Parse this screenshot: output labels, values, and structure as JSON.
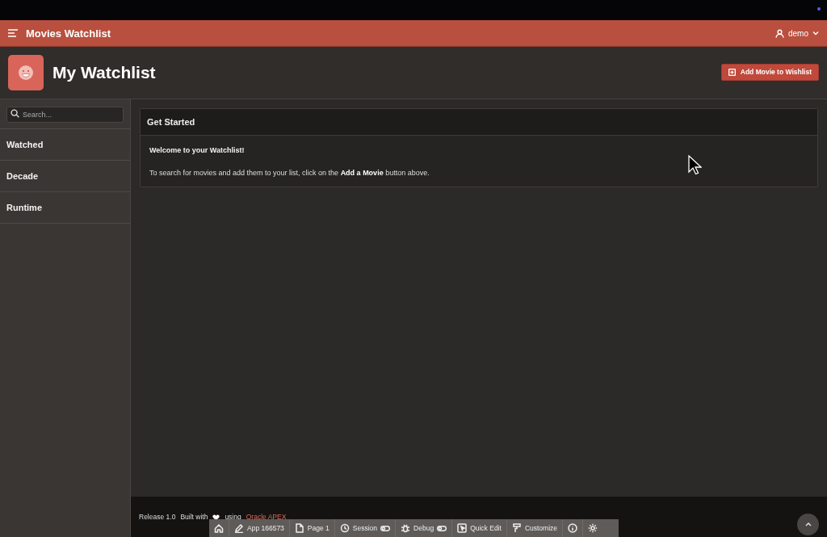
{
  "header": {
    "title": "Movies Watchlist",
    "user": "demo"
  },
  "hero": {
    "title": "My Watchlist",
    "button": "Add Movie to Wishlist"
  },
  "sidebar": {
    "search": {
      "placeholder": "Search..."
    },
    "items": [
      {
        "label": "Watched"
      },
      {
        "label": "Decade"
      },
      {
        "label": "Runtime"
      }
    ]
  },
  "region": {
    "title": "Get Started",
    "heading": "Welcome to your Watchlist!",
    "text": "To search for movies and add them to your list, click on the **Add a Movie** button above."
  },
  "footer": {
    "release": "Release 1.0",
    "built_with": "Built with",
    "using": "using",
    "link": "Oracle APEX"
  },
  "dev_toolbar": {
    "items": [
      {
        "kind": "home"
      },
      {
        "kind": "app",
        "label": "App 166573"
      },
      {
        "kind": "page",
        "label": "Page 1"
      },
      {
        "kind": "session",
        "label": "Session"
      },
      {
        "kind": "debug",
        "label": "Debug"
      },
      {
        "kind": "quick-edit",
        "label": "Quick Edit"
      },
      {
        "kind": "customize",
        "label": "Customize"
      },
      {
        "kind": "info"
      },
      {
        "kind": "settings"
      }
    ]
  }
}
